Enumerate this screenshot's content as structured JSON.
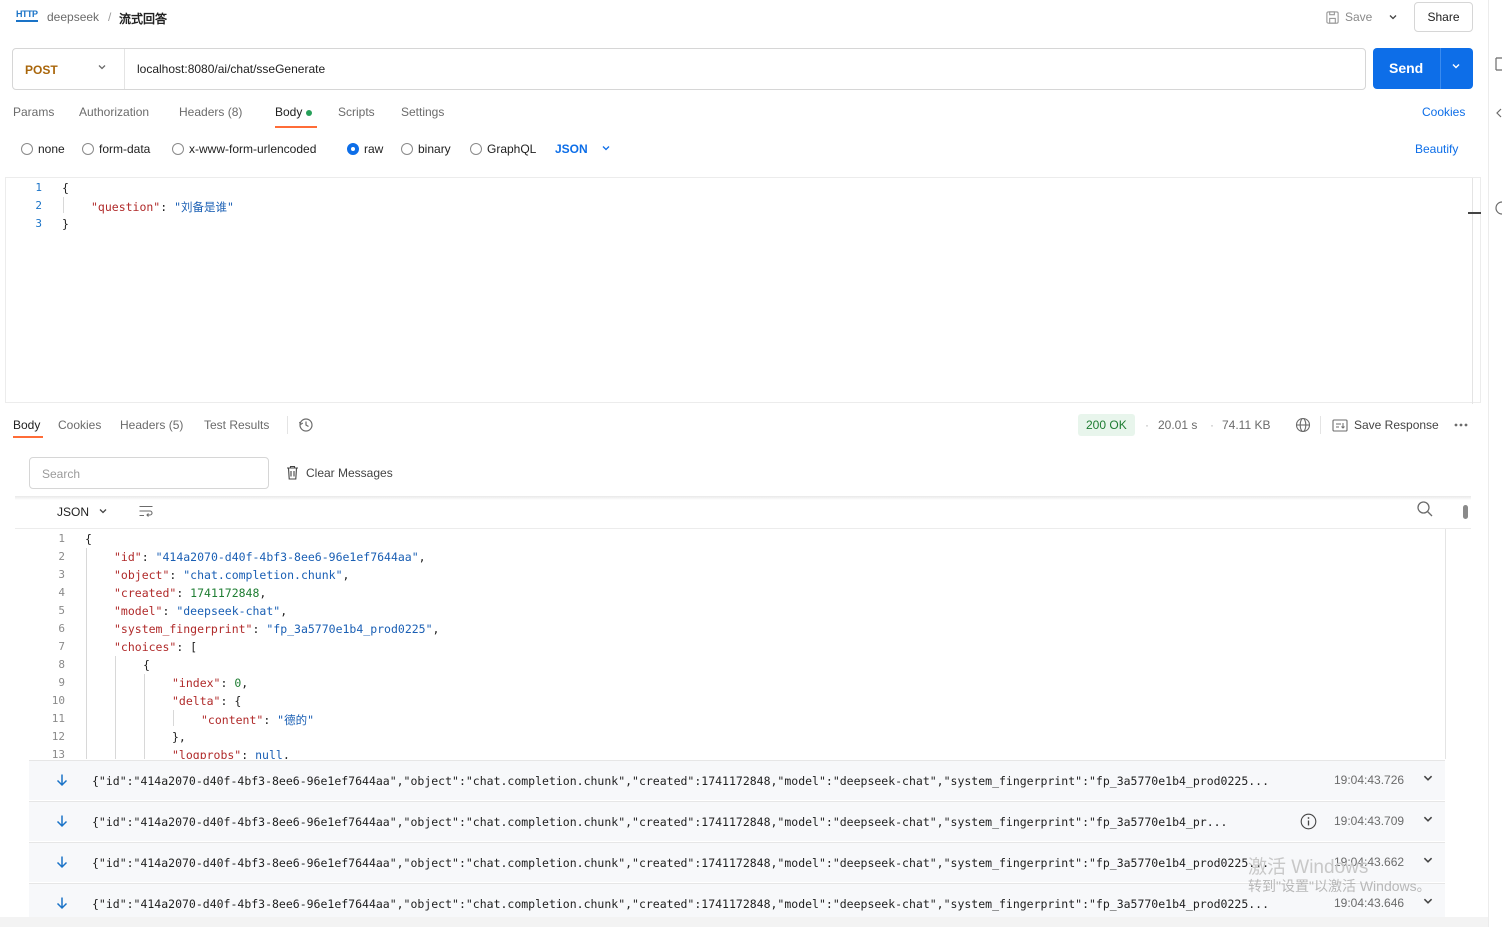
{
  "topbar": {
    "collection": "deepseek",
    "separator": "/",
    "request_name": "流式回答",
    "save_label": "Save",
    "share_label": "Share"
  },
  "request": {
    "method": "POST",
    "url": "localhost:8080/ai/chat/sseGenerate",
    "send_label": "Send"
  },
  "request_tabs": [
    {
      "label": "Params"
    },
    {
      "label": "Authorization"
    },
    {
      "label": "Headers (8)"
    },
    {
      "label": "Body"
    },
    {
      "label": "Scripts"
    },
    {
      "label": "Settings"
    }
  ],
  "cookies_label": "Cookies",
  "body_types": [
    "none",
    "form-data",
    "x-www-form-urlencoded",
    "raw",
    "binary",
    "GraphQL"
  ],
  "selected_body_type": "raw",
  "raw_format": "JSON",
  "beautify_label": "Beautify",
  "request_body": {
    "line_numbers": [
      "1",
      "2",
      "3"
    ],
    "open_brace": "{",
    "key": "\"question\"",
    "colon": ": ",
    "value": "\"刘备是谁\"",
    "close_brace": "}"
  },
  "response_tabs": [
    {
      "label": "Body"
    },
    {
      "label": "Cookies"
    },
    {
      "label": "Headers (5)"
    },
    {
      "label": "Test Results"
    }
  ],
  "response_meta": {
    "status": "200 OK",
    "time": "20.01 s",
    "size": "74.11 KB",
    "save_response_label": "Save Response",
    "status_color": "#1e7d32"
  },
  "search": {
    "placeholder": "Search"
  },
  "clear_messages_label": "Clear Messages",
  "viewer_format": "JSON",
  "response_body": {
    "line_numbers": [
      "1",
      "2",
      "3",
      "4",
      "5",
      "6",
      "7",
      "8",
      "9",
      "10",
      "11",
      "12",
      "13"
    ],
    "l1": "{",
    "id_key": "\"id\"",
    "id_val": "\"414a2070-d40f-4bf3-8ee6-96e1ef7644aa\"",
    "object_key": "\"object\"",
    "object_val": "\"chat.completion.chunk\"",
    "created_key": "\"created\"",
    "created_val": "1741172848",
    "model_key": "\"model\"",
    "model_val": "\"deepseek-chat\"",
    "fp_key": "\"system_fingerprint\"",
    "fp_val": "\"fp_3a5770e1b4_prod0225\"",
    "choices_key": "\"choices\"",
    "choices_open": "[",
    "l8": "{",
    "index_key": "\"index\"",
    "index_val": "0",
    "delta_key": "\"delta\"",
    "delta_open": "{",
    "content_key": "\"content\"",
    "content_val": "\"德的\"",
    "l12": "},",
    "logprobs_key": "\"logprobs\"",
    "logprobs_val": "null"
  },
  "messages": [
    {
      "text": "{\"id\":\"414a2070-d40f-4bf3-8ee6-96e1ef7644aa\",\"object\":\"chat.completion.chunk\",\"created\":1741172848,\"model\":\"deepseek-chat\",\"system_fingerprint\":\"fp_3a5770e1b4_prod0225...",
      "time": "19:04:43.726"
    },
    {
      "text": "{\"id\":\"414a2070-d40f-4bf3-8ee6-96e1ef7644aa\",\"object\":\"chat.completion.chunk\",\"created\":1741172848,\"model\":\"deepseek-chat\",\"system_fingerprint\":\"fp_3a5770e1b4_pr...",
      "time": "19:04:43.709"
    },
    {
      "text": "{\"id\":\"414a2070-d40f-4bf3-8ee6-96e1ef7644aa\",\"object\":\"chat.completion.chunk\",\"created\":1741172848,\"model\":\"deepseek-chat\",\"system_fingerprint\":\"fp_3a5770e1b4_prod0225...",
      "time": "19:04:43.662"
    },
    {
      "text": "{\"id\":\"414a2070-d40f-4bf3-8ee6-96e1ef7644aa\",\"object\":\"chat.completion.chunk\",\"created\":1741172848,\"model\":\"deepseek-chat\",\"system_fingerprint\":\"fp_3a5770e1b4_prod0225...",
      "time": "19:04:43.646"
    }
  ],
  "os_watermark": {
    "line1": "激活 Windows",
    "line2": "转到\"设置\"以激活 Windows。"
  },
  "colors": {
    "accent": "#0d6ee8",
    "tab_indicator": "#ff6c37",
    "method": "#a9660b"
  }
}
